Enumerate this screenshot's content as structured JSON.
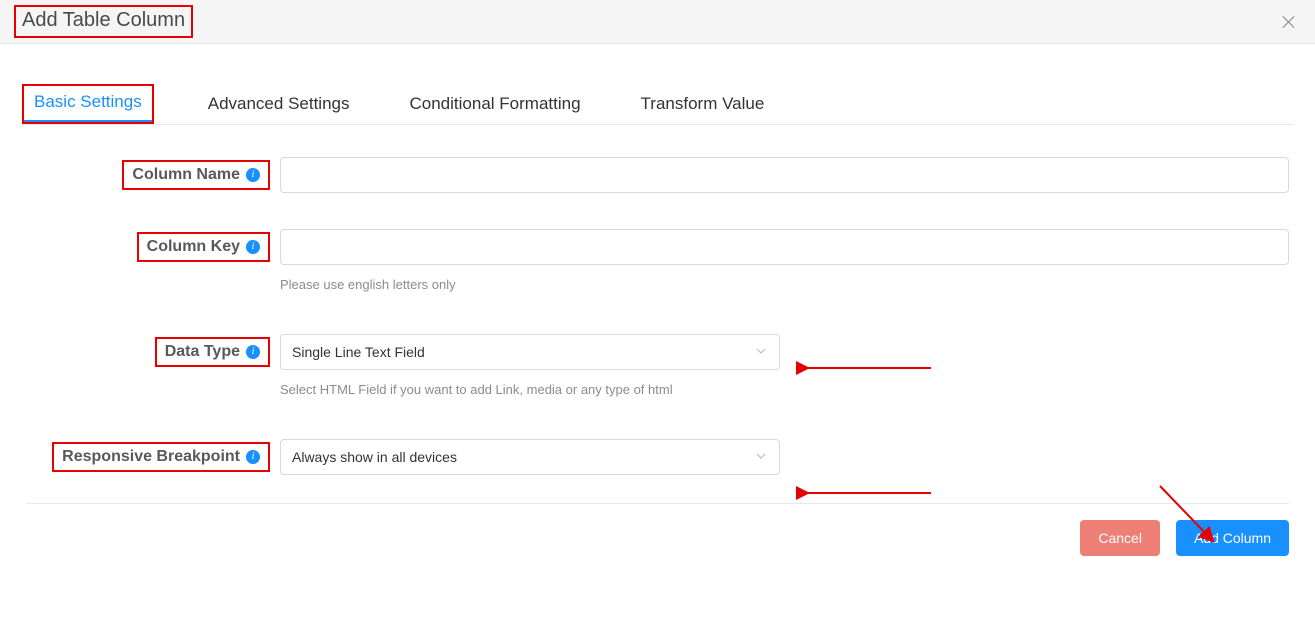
{
  "header": {
    "title": "Add Table Column"
  },
  "tabs": {
    "active": "Basic Settings",
    "items": [
      "Basic Settings",
      "Advanced Settings",
      "Conditional Formatting",
      "Transform Value"
    ]
  },
  "form": {
    "column_name": {
      "label": "Column Name",
      "value": ""
    },
    "column_key": {
      "label": "Column Key",
      "value": "",
      "help": "Please use english letters only"
    },
    "data_type": {
      "label": "Data Type",
      "value": "Single Line Text Field",
      "help": "Select HTML Field if you want to add Link, media or any type of html"
    },
    "responsive_breakpoint": {
      "label": "Responsive Breakpoint",
      "value": "Always show in all devices"
    }
  },
  "footer": {
    "cancel": "Cancel",
    "add": "Add Column"
  }
}
